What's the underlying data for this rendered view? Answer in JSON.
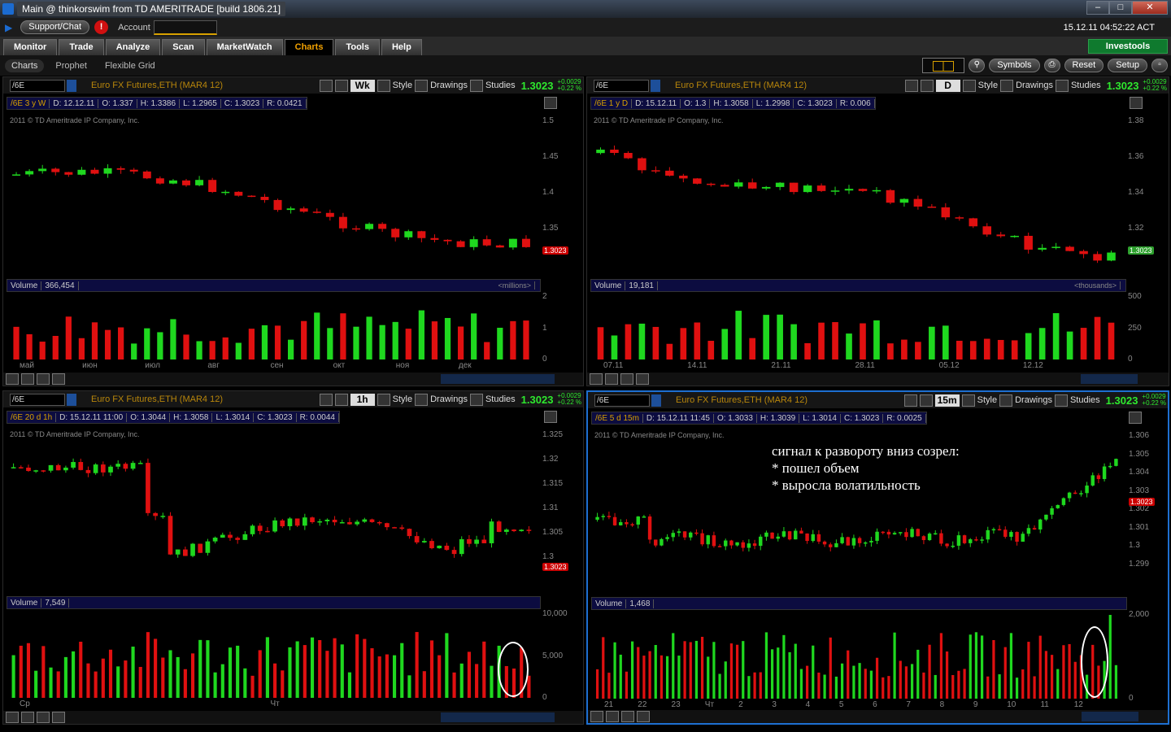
{
  "window": {
    "title": "Main @ thinkorswim from TD AMERITRADE [build 1806.21]"
  },
  "topbar": {
    "support": "Support/Chat",
    "alert": "!",
    "account_label": "Account",
    "clock": "15.12.11 04:52:22 ACT"
  },
  "nav": {
    "tabs": [
      "Monitor",
      "Trade",
      "Analyze",
      "Scan",
      "MarketWatch",
      "Charts",
      "Tools",
      "Help"
    ],
    "active": "Charts",
    "investools": "Investools"
  },
  "subnav": {
    "tabs": [
      "Charts",
      "Prophet",
      "Flexible Grid"
    ],
    "active": "Charts",
    "buttons": {
      "symbols": "Symbols",
      "reset": "Reset",
      "setup": "Setup"
    }
  },
  "common": {
    "symbol": "/6E",
    "description": "Euro FX Futures,ETH (MAR4 12)",
    "style": "Style",
    "drawings": "Drawings",
    "studies": "Studies",
    "price": "1.3023",
    "change": "+0.0029",
    "change_pct": "+0.22 %",
    "copyright": "2011 © TD Ameritrade IP Company, Inc.",
    "volume_label": "Volume"
  },
  "panels": [
    {
      "id": "tl",
      "aggregation": "Wk",
      "info": {
        "id": "/6E 3 y W",
        "d": "D: 12.12.11",
        "o": "O: 1.337",
        "h": "H: 1.3386",
        "l": "L: 1.2965",
        "c": "C: 1.3023",
        "r": "R: 0.0421"
      },
      "price_axis": [
        "1.5",
        "1.45",
        "1.4",
        "1.35"
      ],
      "last_price": "1.3023",
      "volume": "366,454",
      "vol_unit": "<millions>",
      "vol_axis": [
        "2",
        "1",
        "0"
      ],
      "x_labels": [
        "май",
        "июн",
        "июл",
        "авг",
        "сен",
        "окт",
        "ноя",
        "дек"
      ]
    },
    {
      "id": "tr",
      "aggregation": "D",
      "info": {
        "id": "/6E 1 y D",
        "d": "D: 15.12.11",
        "o": "O: 1.3",
        "h": "H: 1.3058",
        "l": "L: 1.2998",
        "c": "C: 1.3023",
        "r": "R: 0.006"
      },
      "price_axis": [
        "1.38",
        "1.36",
        "1.34",
        "1.32"
      ],
      "last_price": "1.3023",
      "volume": "19,181",
      "vol_unit": "<thousands>",
      "vol_axis": [
        "500",
        "250",
        "0"
      ],
      "x_labels": [
        "07.11",
        "14.11",
        "21.11",
        "28.11",
        "05.12",
        "12.12"
      ]
    },
    {
      "id": "bl",
      "aggregation": "1h",
      "info": {
        "id": "/6E 20 d 1h",
        "d": "D: 15.12.11 11:00",
        "o": "O: 1.3044",
        "h": "H: 1.3058",
        "l": "L: 1.3014",
        "c": "C: 1.3023",
        "r": "R: 0.0044"
      },
      "price_axis": [
        "1.325",
        "1.32",
        "1.315",
        "1.31",
        "1.305",
        "1.3"
      ],
      "last_price": "1.3023",
      "volume": "7,549",
      "vol_unit": "",
      "vol_axis": [
        "10,000",
        "5,000",
        "0"
      ],
      "x_labels": [
        "Ср",
        "Чт"
      ]
    },
    {
      "id": "br",
      "aggregation": "15m",
      "info": {
        "id": "/6E 5 d 15m",
        "d": "D: 15.12.11 11:45",
        "o": "O: 1.3033",
        "h": "H: 1.3039",
        "l": "L: 1.3014",
        "c": "C: 1.3023",
        "r": "R: 0.0025"
      },
      "price_axis": [
        "1.306",
        "1.305",
        "1.304",
        "1.303",
        "1.302",
        "1.301",
        "1.3",
        "1.299"
      ],
      "last_price": "1.3023",
      "volume": "1,468",
      "vol_unit": "",
      "vol_axis": [
        "2,000",
        "0"
      ],
      "x_labels": [
        "21",
        "22",
        "23",
        "Чт",
        "2",
        "3",
        "4",
        "5",
        "6",
        "7",
        "8",
        "9",
        "10",
        "11",
        "12"
      ],
      "annotation": [
        "сигнал к развороту вниз созрел:",
        "*  пошел объем",
        "*  выросла волатильность"
      ]
    }
  ]
}
